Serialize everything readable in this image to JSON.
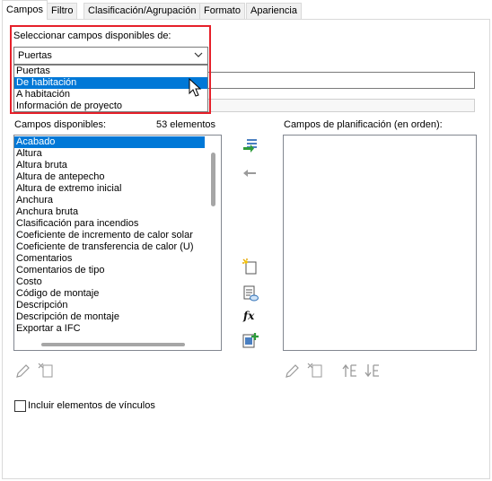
{
  "tabs": [
    "Campos",
    "Filtro",
    "Clasificación/Agrupación",
    "Formato",
    "Apariencia"
  ],
  "select_category": {
    "label": "Seleccionar campos disponibles de:",
    "selected": "Puertas",
    "options": [
      "Puertas",
      "De habitación",
      "A habitación",
      "Información de proyecto"
    ],
    "highlighted_option": "De habitación"
  },
  "available_fields": {
    "label": "Campos disponibles:",
    "count": "53 elementos",
    "items": [
      "Acabado",
      "Altura",
      "Altura bruta",
      "Altura de antepecho",
      "Altura de extremo inicial",
      "Anchura",
      "Anchura bruta",
      "Clasificación para incendios",
      "Coeficiente de incremento de calor solar",
      "Coeficiente de transferencia de calor (U)",
      "Comentarios",
      "Comentarios de tipo",
      "Costo",
      "Código de montaje",
      "Descripción",
      "Descripción de montaje",
      "Exportar a IFC"
    ],
    "selected_item": "Acabado"
  },
  "scheduled_fields": {
    "label": "Campos de planificación (en orden):",
    "items": []
  },
  "include_links": {
    "label": "Incluir elementos de vínculos",
    "checked": false
  },
  "colors": {
    "selection": "#0078d7",
    "highlight_border": "#e6202a",
    "add_arrow": "#2e9b3a"
  }
}
